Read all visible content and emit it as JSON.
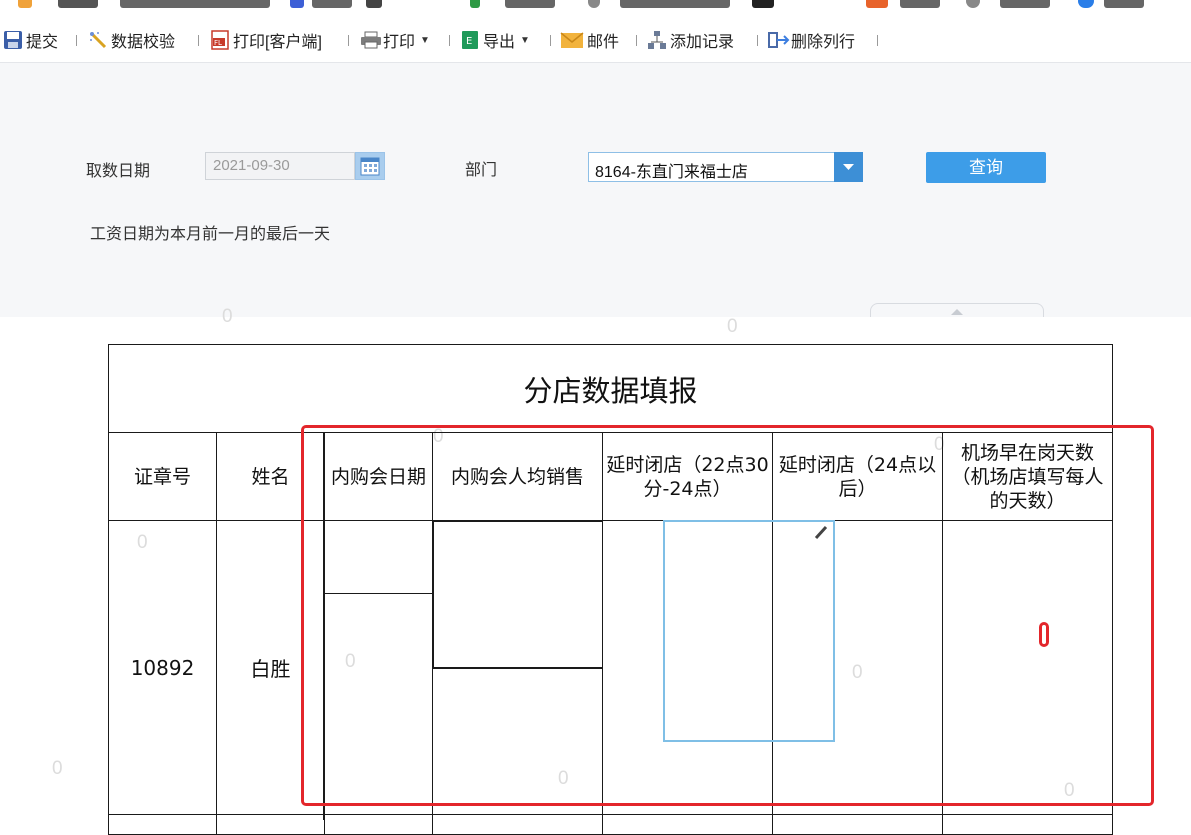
{
  "toolbar": {
    "submit": "提交",
    "validate": "数据校验",
    "print_client": "打印[客户端]",
    "print": "打印",
    "export": "导出",
    "email": "邮件",
    "add_record": "添加记录",
    "delete_row": "删除列行"
  },
  "params": {
    "date_label": "取数日期",
    "date_value": "2021-09-30",
    "dept_label": "部门",
    "dept_value": "8164-东直门来福士店",
    "query_label": "查询",
    "note": "工资日期为本月前一月的最后一天"
  },
  "report": {
    "title": "分店数据填报",
    "headers": {
      "badge_no": "证章号",
      "name": "姓名",
      "purchase_date": "内购会日期",
      "purchase_avg_sales": "内购会人均销售",
      "late_close_1": "延时闭店（22点30分-24点）",
      "late_close_2": "延时闭店（24点以后）",
      "airport_days": "机场早在岗天数（机场店填写每人的天数）"
    },
    "row": {
      "badge_no": "10892",
      "name": "白胜"
    },
    "watermark": "0"
  },
  "colors": {
    "accent": "#3d9de8",
    "highlight": "#e3262b",
    "selection": "#7fbfe6"
  }
}
